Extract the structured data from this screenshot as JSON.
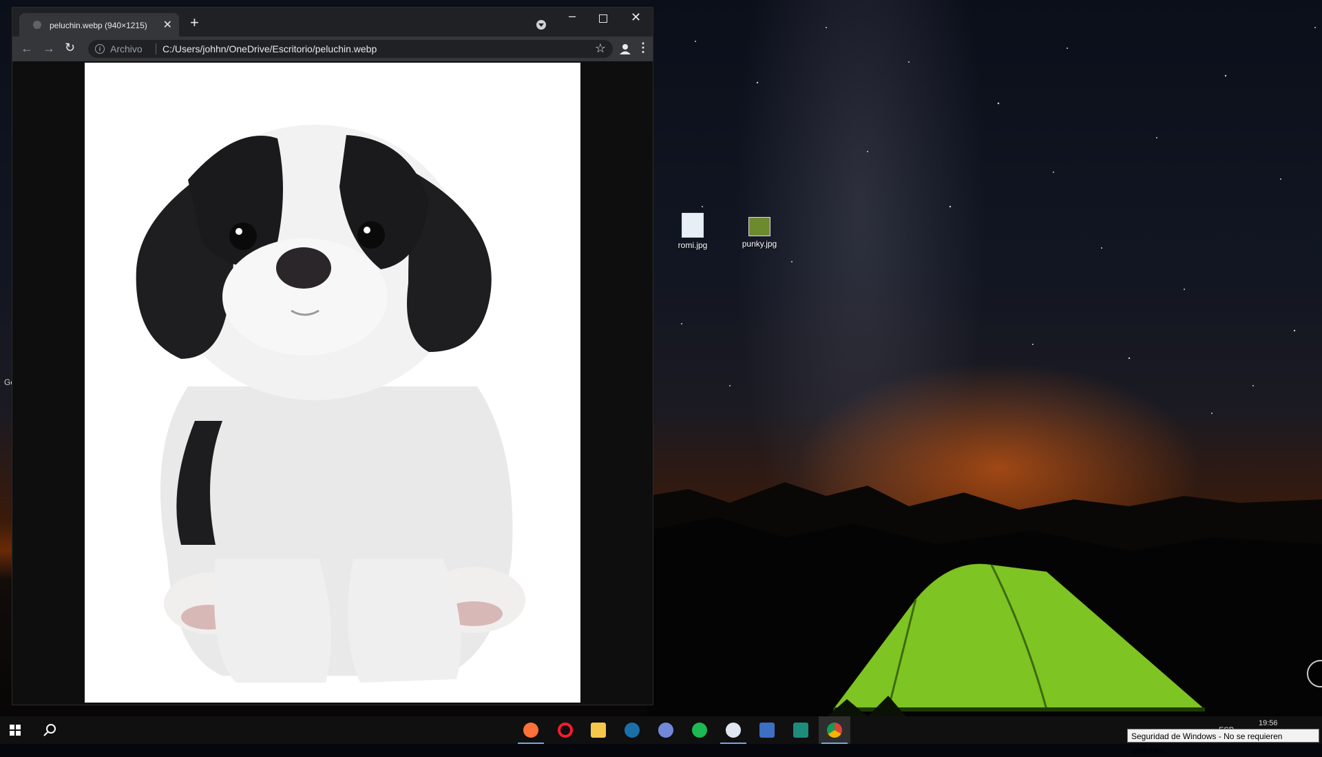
{
  "browser": {
    "tab_title": "peluchin.webp (940×1215)",
    "scheme_label": "Archivo",
    "url": "C:/Users/johhn/OneDrive/Escritorio/peluchin.webp",
    "icons": {
      "back": "arrow-left-icon",
      "forward": "arrow-right-icon",
      "reload": "reload-icon",
      "info": "info-icon",
      "bookmark": "star-icon",
      "profile": "person-icon",
      "menu": "kebab-menu-icon"
    }
  },
  "content": {
    "image_description_icon": "puppy-figurine-image"
  },
  "desktop": {
    "icons": [
      {
        "label": "romi.jpg"
      },
      {
        "label": "punky.jpg"
      }
    ],
    "edge_text": "Gc"
  },
  "taskbar": {
    "apps": [
      "firefox",
      "opera",
      "file-explorer",
      "steam",
      "discord",
      "spotify",
      "app-w",
      "network-app",
      "app-s",
      "chrome"
    ],
    "tray": {
      "language": "ESP",
      "time": "19:56"
    },
    "tooltip": "Seguridad de Windows - No se requieren acciones."
  },
  "colors": {
    "chrome_dark": "#202124",
    "chrome_toolbar": "#35363a",
    "taskbar": "#101010"
  }
}
